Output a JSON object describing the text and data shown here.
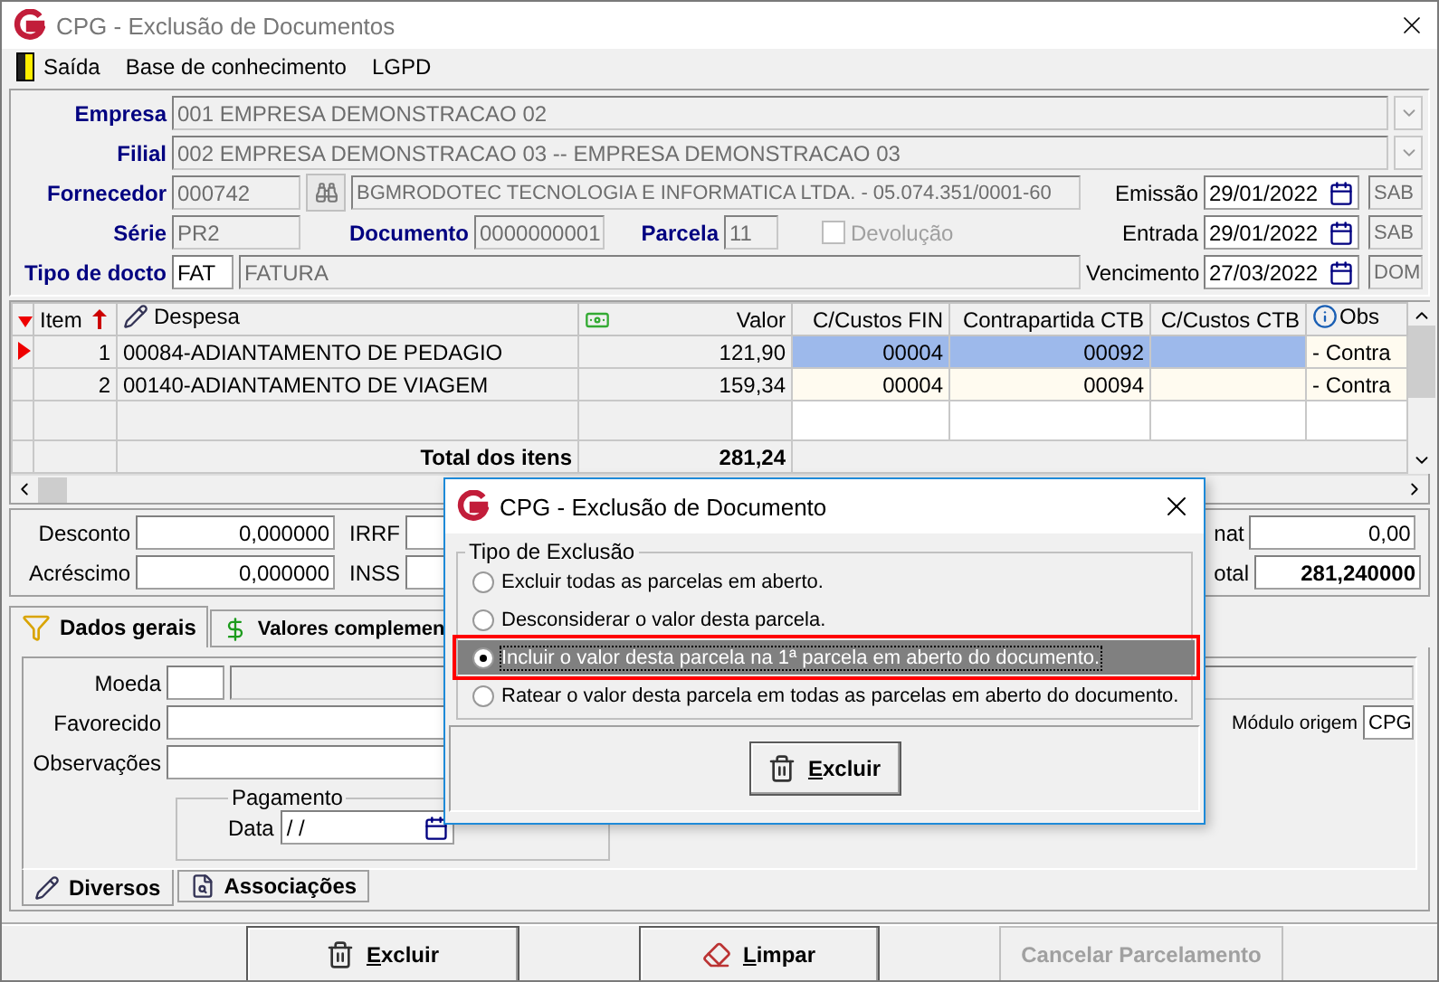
{
  "window": {
    "title": "CPG - Exclusão de Documentos"
  },
  "menu": [
    {
      "label": "Saída"
    },
    {
      "label": "Base de conhecimento"
    },
    {
      "label": "LGPD"
    }
  ],
  "header": {
    "empresa": {
      "label": "Empresa",
      "value": "001 EMPRESA DEMONSTRACAO 02"
    },
    "filial": {
      "label": "Filial",
      "value": "002 EMPRESA DEMONSTRACAO 03 -- EMPRESA DEMONSTRACAO 03"
    },
    "fornecedor": {
      "label": "Fornecedor",
      "code": "000742",
      "name": "BGMRODOTEC TECNOLOGIA E INFORMATICA LTDA. - 05.074.351/0001-60"
    },
    "serie": {
      "label": "Série",
      "value": "PR2"
    },
    "documento": {
      "label": "Documento",
      "value": "0000000001"
    },
    "parcela": {
      "label": "Parcela",
      "value": "11"
    },
    "devolucao": {
      "label": "Devolução",
      "checked": false,
      "disabled": true
    },
    "tipo": {
      "label": "Tipo de docto",
      "code": "FAT",
      "name": "FATURA"
    },
    "dates": [
      {
        "label": "Emissão",
        "value": "29/01/2022",
        "day": "SAB"
      },
      {
        "label": "Entrada",
        "value": "29/01/2022",
        "day": "SAB"
      },
      {
        "label": "Vencimento",
        "value": "27/03/2022",
        "day": "DOM"
      }
    ]
  },
  "grid": {
    "columns": [
      "Item",
      "Despesa",
      "Valor",
      "C/Custos FIN",
      "Contrapartida CTB",
      "C/Custos CTB",
      "Obs"
    ],
    "rows": [
      {
        "selected": true,
        "item": "1",
        "despesa": "00084-ADIANTAMENTO DE PEDAGIO",
        "valor": "121,90",
        "cc_fin": "00004",
        "contrapartida": "00092",
        "obs": "- Contra"
      },
      {
        "selected": false,
        "item": "2",
        "despesa": "00140-ADIANTAMENTO DE VIAGEM",
        "valor": "159,34",
        "cc_fin": "00004",
        "contrapartida": "00094",
        "obs": "- Contra"
      }
    ],
    "total": {
      "label": "Total dos itens",
      "value": "281,24"
    }
  },
  "totals": {
    "left": [
      {
        "label": "Desconto",
        "value": "0,000000"
      },
      {
        "label": "Acréscimo",
        "value": "0,000000"
      }
    ],
    "taxes": [
      {
        "label": "IRRF"
      },
      {
        "label": "INSS"
      }
    ],
    "right": [
      {
        "label": "nat",
        "value": "0,00",
        "bold": false
      },
      {
        "label": "otal",
        "value": "281,240000",
        "bold": true
      }
    ]
  },
  "tabs": [
    {
      "label": "Dados gerais",
      "selected": true
    },
    {
      "label": "Valores complemen",
      "selected": false
    }
  ],
  "panel": {
    "moeda": "Moeda",
    "favorecido": "Favorecido",
    "observacoes": "Observações",
    "pagamento": {
      "title": "Pagamento",
      "label": "Data",
      "value": "/ /"
    },
    "modulo": {
      "label": "Módulo origem",
      "value": "CPG"
    }
  },
  "subtabs": [
    {
      "label": "Diversos",
      "selected": true
    },
    {
      "label": "Associações",
      "selected": false
    }
  ],
  "buttons": [
    {
      "label": "Excluir",
      "accelerator": true,
      "disabled": false
    },
    {
      "label": "Limpar",
      "accelerator": true,
      "disabled": false
    },
    {
      "label": "Cancelar Parcelamento",
      "accelerator": false,
      "disabled": true
    }
  ],
  "dialog": {
    "title": "CPG - Exclusão de Documento",
    "group": "Tipo de Exclusão",
    "options": [
      {
        "label": "Excluir todas as parcelas em aberto.",
        "selected": false
      },
      {
        "label": "Desconsiderar o valor desta  parcela.",
        "selected": false
      },
      {
        "label": "Incluir o valor desta parcela na 1ª parcela em aberto do documento.",
        "selected": true
      },
      {
        "label": "Ratear o valor desta parcela em todas as parcelas em aberto do documento.",
        "selected": false
      }
    ],
    "button": {
      "label": "Excluir",
      "accelerator": true
    }
  }
}
